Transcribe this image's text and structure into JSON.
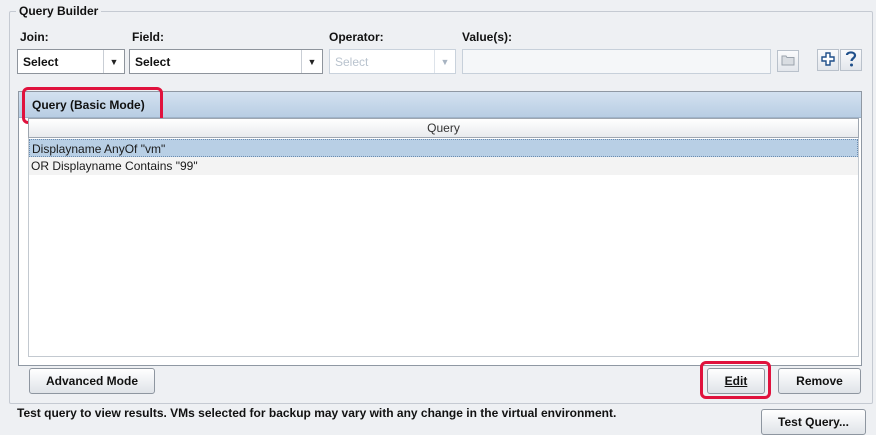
{
  "group": {
    "title": "Query Builder"
  },
  "fields": {
    "join_label": "Join:",
    "join_value": "Select",
    "field_label": "Field:",
    "field_value": "Select",
    "operator_label": "Operator:",
    "operator_value": "Select",
    "values_label": "Value(s):",
    "values_value": ""
  },
  "panel": {
    "title": "Query (Basic Mode)",
    "column_header": "Query",
    "rows": [
      "Displayname AnyOf \"vm\"",
      "OR Displayname Contains \"99\""
    ]
  },
  "buttons": {
    "advanced": "Advanced Mode",
    "edit": "Edit",
    "remove": "Remove",
    "test_query": "Test Query..."
  },
  "status_text": "Test query to view results. VMs selected for backup may vary with any change in the virtual environment.",
  "colors": {
    "highlight": "#e0123d",
    "selected_row": "#b8cfe5",
    "panel_header": "#c5d7ea"
  },
  "icons": [
    "chevron-down-icon",
    "folder-icon",
    "add-icon",
    "help-icon"
  ]
}
